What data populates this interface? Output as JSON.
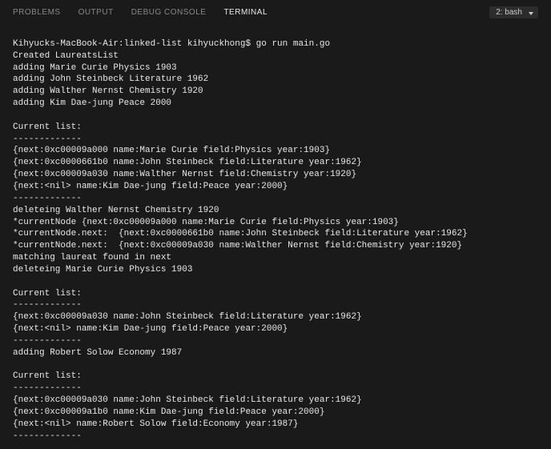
{
  "header": {
    "tabs": [
      {
        "label": "PROBLEMS",
        "active": false
      },
      {
        "label": "OUTPUT",
        "active": false
      },
      {
        "label": "DEBUG CONSOLE",
        "active": false
      },
      {
        "label": "TERMINAL",
        "active": true
      }
    ],
    "terminal_selector": "2: bash"
  },
  "terminal": {
    "lines": [
      "Kihyucks-MacBook-Air:linked-list kihyuckhong$ go run main.go",
      "Created LaureatsList",
      "adding Marie Curie Physics 1903",
      "adding John Steinbeck Literature 1962",
      "adding Walther Nernst Chemistry 1920",
      "adding Kim Dae-jung Peace 2000",
      "",
      "Current list:",
      "-------------",
      "{next:0xc00009a000 name:Marie Curie field:Physics year:1903}",
      "{next:0xc0000661b0 name:John Steinbeck field:Literature year:1962}",
      "{next:0xc00009a030 name:Walther Nernst field:Chemistry year:1920}",
      "{next:<nil> name:Kim Dae-jung field:Peace year:2000}",
      "-------------",
      "deleteing Walther Nernst Chemistry 1920",
      "*currentNode {next:0xc00009a000 name:Marie Curie field:Physics year:1903}",
      "*currentNode.next:  {next:0xc0000661b0 name:John Steinbeck field:Literature year:1962}",
      "*currentNode.next:  {next:0xc00009a030 name:Walther Nernst field:Chemistry year:1920}",
      "matching laureat found in next",
      "deleteing Marie Curie Physics 1903",
      "",
      "Current list:",
      "-------------",
      "{next:0xc00009a030 name:John Steinbeck field:Literature year:1962}",
      "{next:<nil> name:Kim Dae-jung field:Peace year:2000}",
      "-------------",
      "adding Robert Solow Economy 1987",
      "",
      "Current list:",
      "-------------",
      "{next:0xc00009a030 name:John Steinbeck field:Literature year:1962}",
      "{next:0xc00009a1b0 name:Kim Dae-jung field:Peace year:2000}",
      "{next:<nil> name:Robert Solow field:Economy year:1987}",
      "-------------"
    ]
  }
}
